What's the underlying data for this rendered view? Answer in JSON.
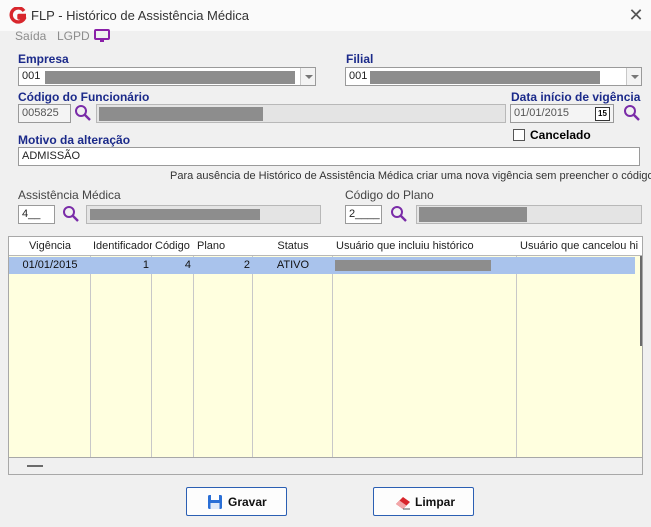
{
  "window": {
    "title": "FLP - Histórico de Assistência Médica",
    "close_glyph": "✕"
  },
  "menu": {
    "items": [
      "Saída",
      "LGPD"
    ],
    "monitor_icon": "monitor-icon"
  },
  "form": {
    "empresa": {
      "label": "Empresa",
      "code": "001"
    },
    "filial": {
      "label": "Filial",
      "code": "001"
    },
    "funcionario": {
      "label": "Código do Funcionário",
      "value": "005825"
    },
    "data_inicio": {
      "label": "Data início de vigência",
      "value": "01/01/2015",
      "calendar_glyph": "15"
    },
    "cancelado": {
      "label": "Cancelado",
      "checked": false
    },
    "motivo": {
      "label": "Motivo da alteração",
      "value": "ADMISSÃO"
    },
    "info": "Para ausência de Histórico de Assistência Médica criar uma nova vigência sem preencher o código",
    "assistencia": {
      "label": "Assistência Médica",
      "value": "4__"
    },
    "plano": {
      "label": "Código do Plano",
      "value": "2____"
    }
  },
  "grid": {
    "columns": [
      "Vigência",
      "Identificador",
      "Código",
      "Plano",
      "Status",
      "Usuário que incluiu histórico",
      "Usuário que cancelou hi"
    ],
    "rows": [
      {
        "vigencia": "01/01/2015",
        "identificador": "1",
        "codigo": "4",
        "plano": "2",
        "status": "ATIVO",
        "usuario_incluiu": "",
        "usuario_cancelou": ""
      }
    ]
  },
  "buttons": {
    "gravar": "Gravar",
    "limpar": "Limpar"
  },
  "colors": {
    "accent_label": "#1b2a8a",
    "selected_row": "#a9c3ec",
    "grid_bg": "#ffffdf",
    "brand_red": "#d8262c",
    "button_border": "#2b5fb3"
  }
}
